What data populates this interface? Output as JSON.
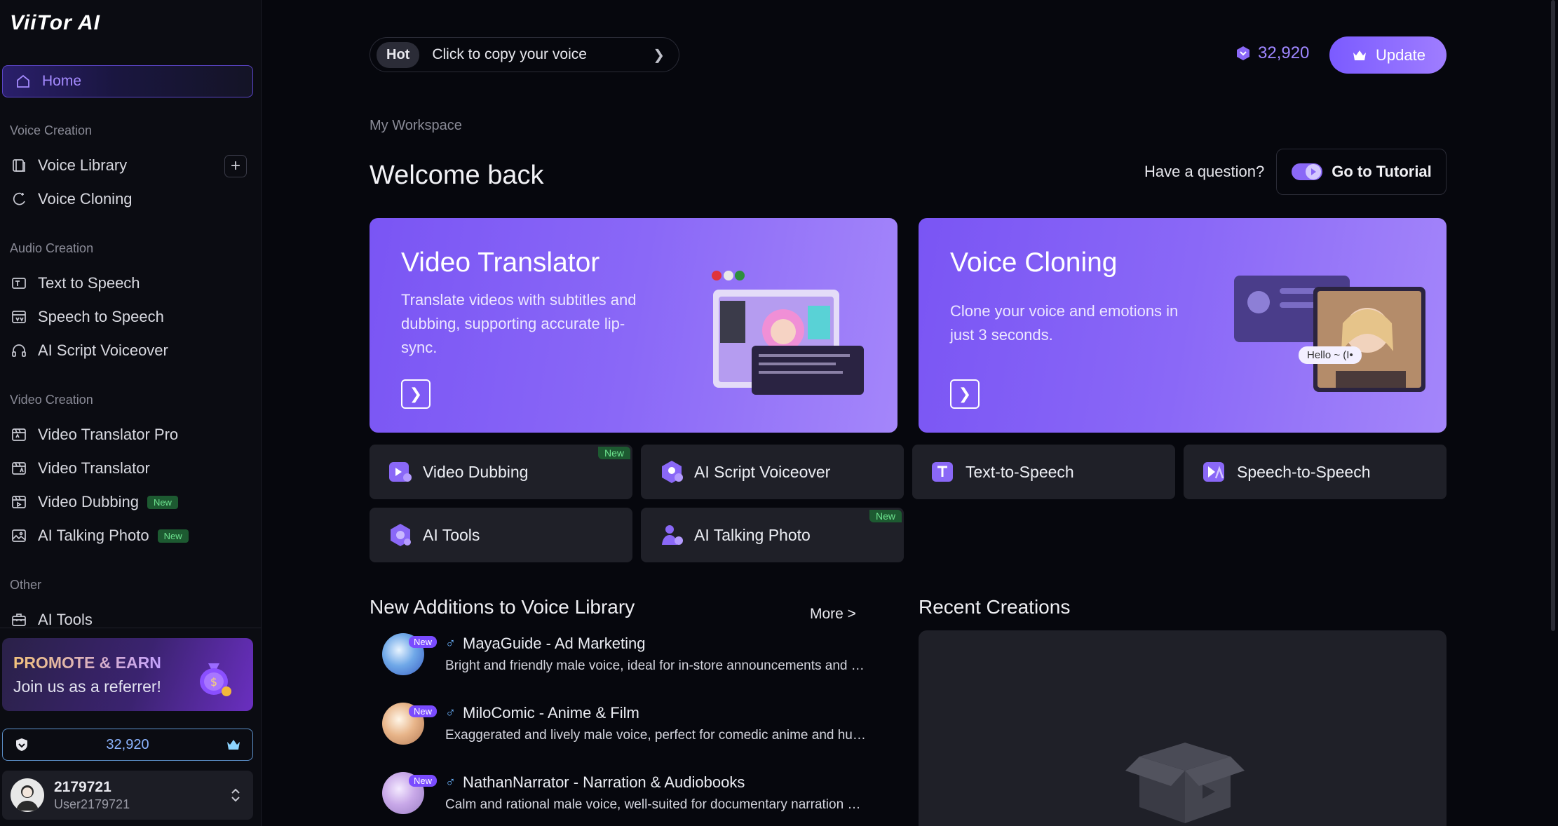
{
  "brand": {
    "logo_text": "ViiTor AI"
  },
  "sidebar": {
    "home_label": "Home",
    "sections": {
      "voice_creation": "Voice Creation",
      "audio_creation": "Audio Creation",
      "video_creation": "Video Creation",
      "other": "Other"
    },
    "items": {
      "voice_library": "Voice Library",
      "voice_cloning": "Voice Cloning",
      "text_to_speech": "Text to Speech",
      "speech_to_speech": "Speech to Speech",
      "ai_script_voiceover": "AI Script Voiceover",
      "video_translator_pro": "Video Translator Pro",
      "video_translator": "Video Translator",
      "video_dubbing": "Video Dubbing",
      "ai_talking_photo": "AI Talking Photo",
      "ai_tools": "AI Tools"
    },
    "new_badge": "New",
    "promo": {
      "title": "PROMOTE & EARN",
      "subtitle": "Join us as a referrer!"
    },
    "credits": "32,920",
    "user": {
      "name": "2179721",
      "handle": "User2179721"
    }
  },
  "header": {
    "hot_tag": "Hot",
    "hot_text": "Click to copy your voice",
    "coins": "32,920",
    "update_label": "Update"
  },
  "main": {
    "workspace_label": "My Workspace",
    "welcome": "Welcome back",
    "question": "Have a question?",
    "tutorial_label": "Go to Tutorial",
    "hero_cards": [
      {
        "title": "Video Translator",
        "desc": "Translate videos with subtitles and dubbing, supporting accurate lip-sync."
      },
      {
        "title": "Voice Cloning",
        "desc": "Clone your voice and emotions in just 3 seconds."
      }
    ],
    "hero_illus_text": "Hello ~ (I•",
    "tiles": [
      {
        "label": "Video Dubbing",
        "new": "New"
      },
      {
        "label": "AI Script Voiceover"
      },
      {
        "label": "Text-to-Speech"
      },
      {
        "label": "Speech-to-Speech"
      },
      {
        "label": "AI Tools"
      },
      {
        "label": "AI Talking Photo",
        "new": "New"
      }
    ],
    "voice_library": {
      "title": "New Additions to Voice Library",
      "more": "More >",
      "new_badge": "New",
      "voices": [
        {
          "name": "MayaGuide - Ad Marketing",
          "desc": "Bright and friendly male voice, ideal for in-store announcements and r…"
        },
        {
          "name": "MiloComic - Anime & Film",
          "desc": "Exaggerated and lively male voice, perfect for comedic anime and hum…"
        },
        {
          "name": "NathanNarrator - Narration & Audiobooks",
          "desc": "Calm and rational male voice, well-suited for documentary narration a…"
        }
      ]
    },
    "recent": {
      "title": "Recent Creations"
    }
  },
  "colors": {
    "accent": "#8a68f7",
    "new_green": "#6de38f",
    "bg": "#06070d"
  }
}
